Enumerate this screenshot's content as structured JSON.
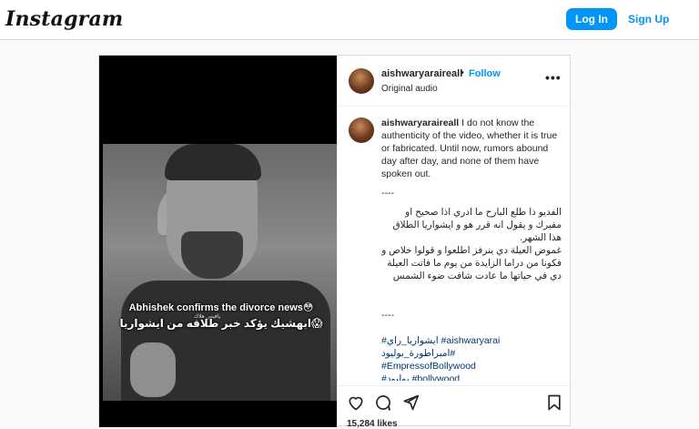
{
  "topbar": {
    "logo": "Instagram",
    "login_label": "Log In",
    "signup_label": "Sign Up"
  },
  "post": {
    "video": {
      "caption_english": "Abhishek confirms the divorce news😳",
      "caption_small": "يافيس هلاك",
      "caption_arabic": "ابهشيك يؤكد خبر طلاقه من ايشواريا😱"
    },
    "header": {
      "username": "aishwaryaraireall",
      "dot": "•",
      "follow_label": "Follow",
      "audio": "Original audio",
      "more_icon": "more-options-icon"
    },
    "caption": {
      "username": "aishwaryaraireall",
      "text": "I do not know the authenticity of the video, whether it is true or fabricated. Until now, rumors abound day after day, and none of them have spoken out.",
      "separator": "----",
      "arabic_1": "الفديو ذا طلع البارح ما ادري اذا صحيح او مفبرك و يقول انه قرر هو و ايشواريا الطلاق هذا الشهر.",
      "arabic_2": "غموض العيلة دي ينرفز اطلعوا و قولوا خلاص و فكونا من دراما الزايدة من يوم ما فاتت العيلة دي في حياتها ما عادت شافت ضوء الشمس",
      "separator_2": "----",
      "hashtags": [
        "#ايشواريا_راي #aishwaryarai",
        "#امبراطورة_بوليود",
        "#EmpressofBollywood",
        "#بوليود #bollywood"
      ]
    },
    "actions": {
      "like_icon": "heart-icon",
      "comment_icon": "comment-icon",
      "share_icon": "share-icon",
      "save_icon": "bookmark-icon"
    },
    "likes": "15,284 likes"
  }
}
